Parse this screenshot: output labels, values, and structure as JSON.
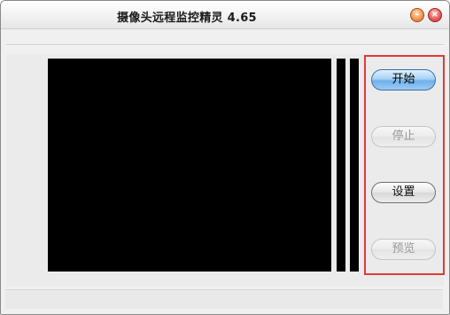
{
  "window": {
    "title": "摄像头远程监控精灵  4.65",
    "minimize_glyph": "–",
    "close_glyph": "×"
  },
  "controls": {
    "start": "开始",
    "stop": "停止",
    "settings": "设置",
    "preview": "预览"
  },
  "colors": {
    "highlight_border": "#e03a3a",
    "video_background": "#000000",
    "primary_button": "#6fb0ea"
  }
}
